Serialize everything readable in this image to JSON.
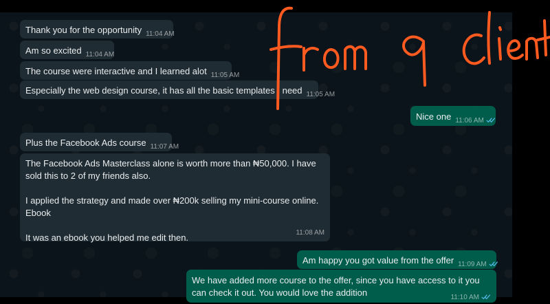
{
  "colors": {
    "background": "#0b141a",
    "incoming_bubble": "#202c33",
    "outgoing_bubble": "#005c4b",
    "text": "#e9edef",
    "read_ticks": "#53bdeb",
    "annotation_ink": "#ff5a1f"
  },
  "annotation": {
    "text": "from a client",
    "style": "handwritten"
  },
  "messages": [
    {
      "direction": "in",
      "text": "Thank you for the opportunity",
      "time": "11:04 AM"
    },
    {
      "direction": "in",
      "text": "Am so excited",
      "time": "11:04 AM"
    },
    {
      "direction": "in",
      "text": "The course were interactive and I learned alot",
      "time": "11:05 AM"
    },
    {
      "direction": "in",
      "text": "Especially the web design course, it has all the basic templates I need",
      "time": "11:05 AM"
    },
    {
      "direction": "out",
      "text": "Nice one",
      "time": "11:06 AM",
      "status": "read-ticks-icon"
    },
    {
      "direction": "in",
      "text": "Plus the Facebook Ads course",
      "time": "11:07 AM"
    },
    {
      "direction": "in",
      "text": "The Facebook Ads Masterclass alone is worth more than ₦50,000. I have sold this to 2 of my friends also.\n\nI applied the strategy and made over ₦200k selling my mini-course online. Ebook\n\nIt was an ebook you helped me edit then.",
      "time": "11:08 AM"
    },
    {
      "direction": "out",
      "text": "Am happy you got value from the offer",
      "time": "11:09 AM",
      "status": "read-ticks-icon"
    },
    {
      "direction": "out",
      "text": "We have added more course to the offer, since you have access to it you can check it out. You would love the addition",
      "time": "11:10 AM",
      "status": "read-ticks-icon"
    }
  ]
}
